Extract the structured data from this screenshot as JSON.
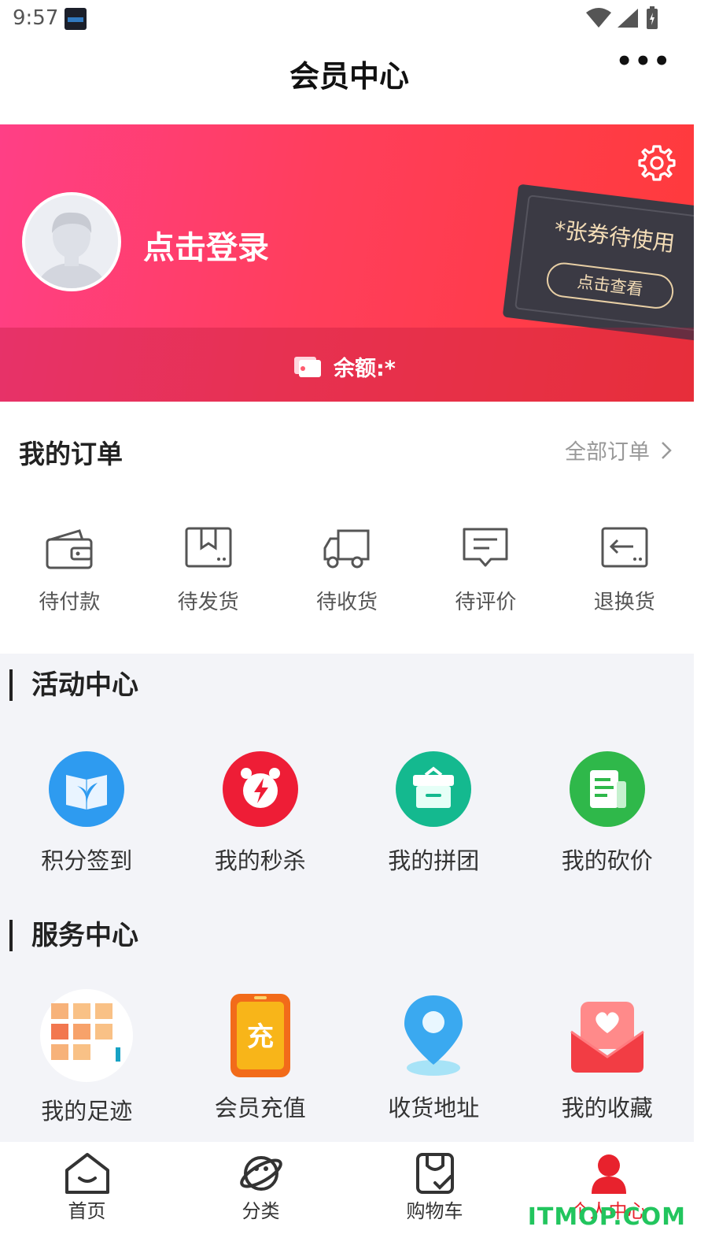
{
  "status_bar": {
    "time": "9:57",
    "icons": [
      "wifi-icon",
      "signal-icon",
      "battery-icon"
    ]
  },
  "header": {
    "title": "会员中心",
    "more_icon": "more-icon"
  },
  "profile": {
    "login_text": "点击登录",
    "coupon_text": "*张券待使用",
    "coupon_button": "点击查看",
    "balance_text": "余额:*",
    "settings_icon": "gear-icon"
  },
  "orders": {
    "title": "我的订单",
    "all_link": "全部订单",
    "items": [
      {
        "label": "待付款",
        "icon": "wallet-icon"
      },
      {
        "label": "待发货",
        "icon": "box-icon"
      },
      {
        "label": "待收货",
        "icon": "truck-icon"
      },
      {
        "label": "待评价",
        "icon": "comment-icon"
      },
      {
        "label": "退换货",
        "icon": "return-icon"
      }
    ]
  },
  "activity": {
    "title": "活动中心",
    "items": [
      {
        "label": "积分签到",
        "icon": "book-leaf-icon",
        "color": "#2e9bf0"
      },
      {
        "label": "我的秒杀",
        "icon": "alarm-icon",
        "color": "#ee1d36"
      },
      {
        "label": "我的拼团",
        "icon": "gift-box-icon",
        "color": "#14b98f"
      },
      {
        "label": "我的砍价",
        "icon": "document-icon",
        "color": "#2fb84a"
      }
    ]
  },
  "service": {
    "title": "服务中心",
    "items": [
      {
        "label": "我的足迹",
        "icon": "footprint-grid-icon"
      },
      {
        "label": "会员充值",
        "icon": "recharge-phone-icon"
      },
      {
        "label": "收货地址",
        "icon": "location-pin-icon"
      },
      {
        "label": "我的收藏",
        "icon": "heart-envelope-icon"
      }
    ]
  },
  "tabbar": {
    "items": [
      {
        "label": "首页",
        "icon": "home-icon"
      },
      {
        "label": "分类",
        "icon": "planet-icon"
      },
      {
        "label": "购物车",
        "icon": "cart-bag-icon"
      },
      {
        "label": "个人中心",
        "icon": "person-icon",
        "active": true
      }
    ]
  },
  "watermark": "ITMOP.COM",
  "colors": {
    "accent": "#ff3e5c",
    "tab_active": "#e8222d",
    "section_bg": "#f3f4f8"
  }
}
